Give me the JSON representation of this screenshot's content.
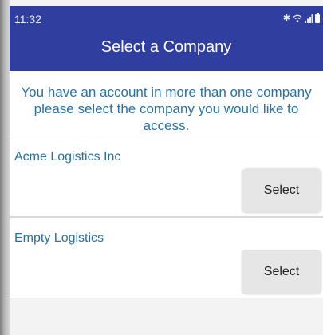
{
  "status_bar": {
    "time": "11:32",
    "icons": [
      "bluetooth-icon",
      "wifi-icon",
      "signal-icon",
      "battery-icon"
    ]
  },
  "app_bar": {
    "title": "Select a Company",
    "color": "#303f9f"
  },
  "intro_text": "You have an account in more than one company please select the company you would like to access.",
  "companies": [
    {
      "name": "Acme Logistics Inc",
      "button_label": "Select"
    },
    {
      "name": "Empty Logistics",
      "button_label": "Select"
    }
  ],
  "colors": {
    "accent_text": "#2672a7",
    "background": "#f3f3f3",
    "button": "#e6e6e6"
  }
}
